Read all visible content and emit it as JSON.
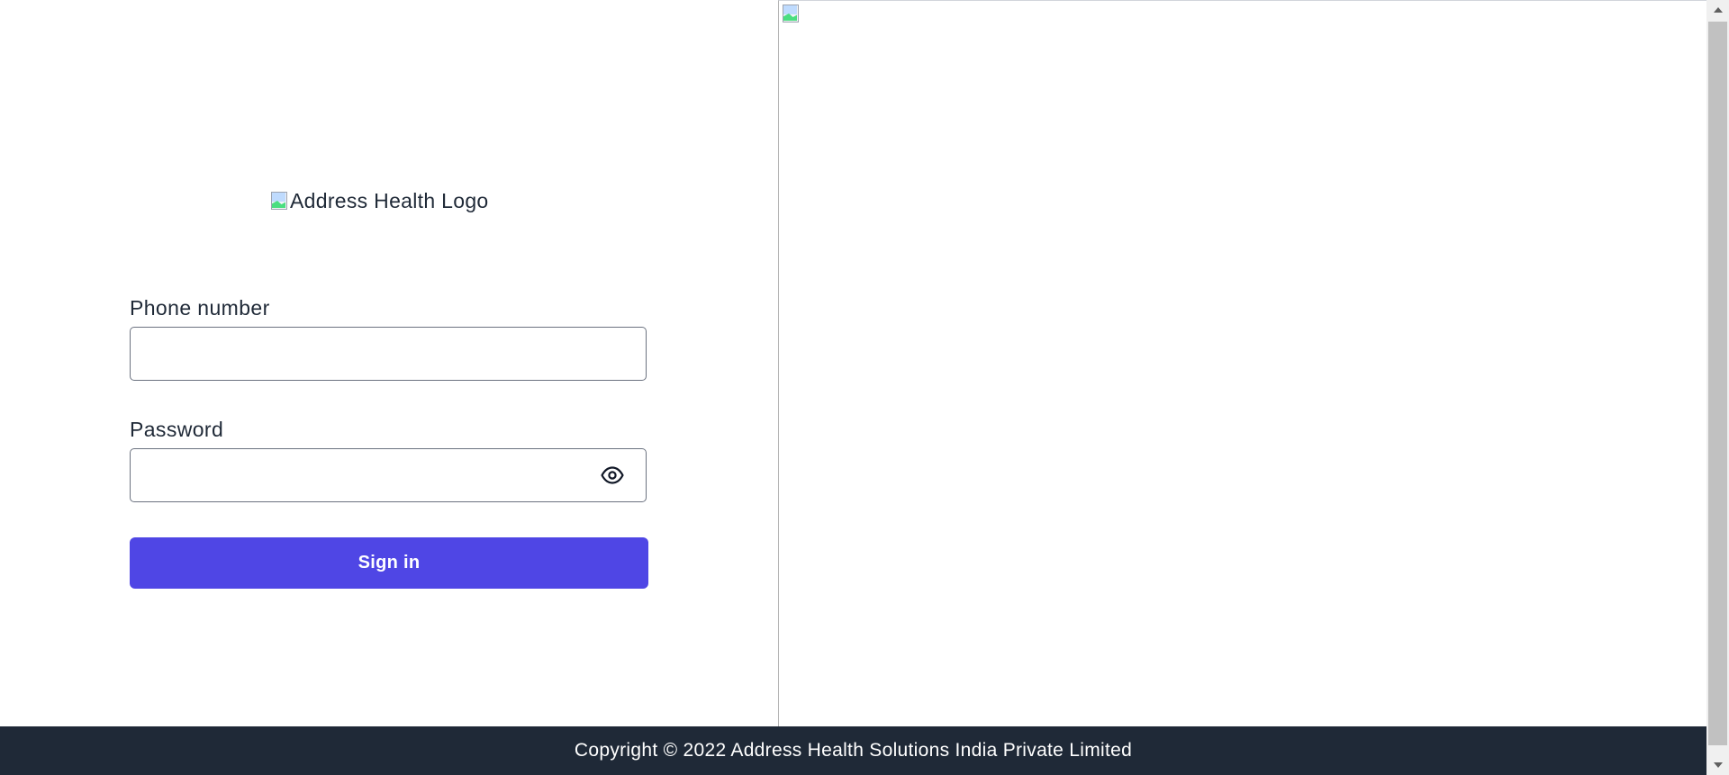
{
  "logo": {
    "alt_text": "Address Health Logo"
  },
  "form": {
    "phone_label": "Phone number",
    "phone_value": "",
    "phone_placeholder": "",
    "password_label": "Password",
    "password_value": "",
    "password_placeholder": "",
    "password_toggle_icon": "eye-icon",
    "signin_label": "Sign in"
  },
  "footer": {
    "copyright": "Copyright © 2022 Address Health Solutions India Private Limited"
  },
  "colors": {
    "primary_button": "#4f46e5",
    "footer_background": "#1f2937",
    "text": "#1f2937"
  }
}
